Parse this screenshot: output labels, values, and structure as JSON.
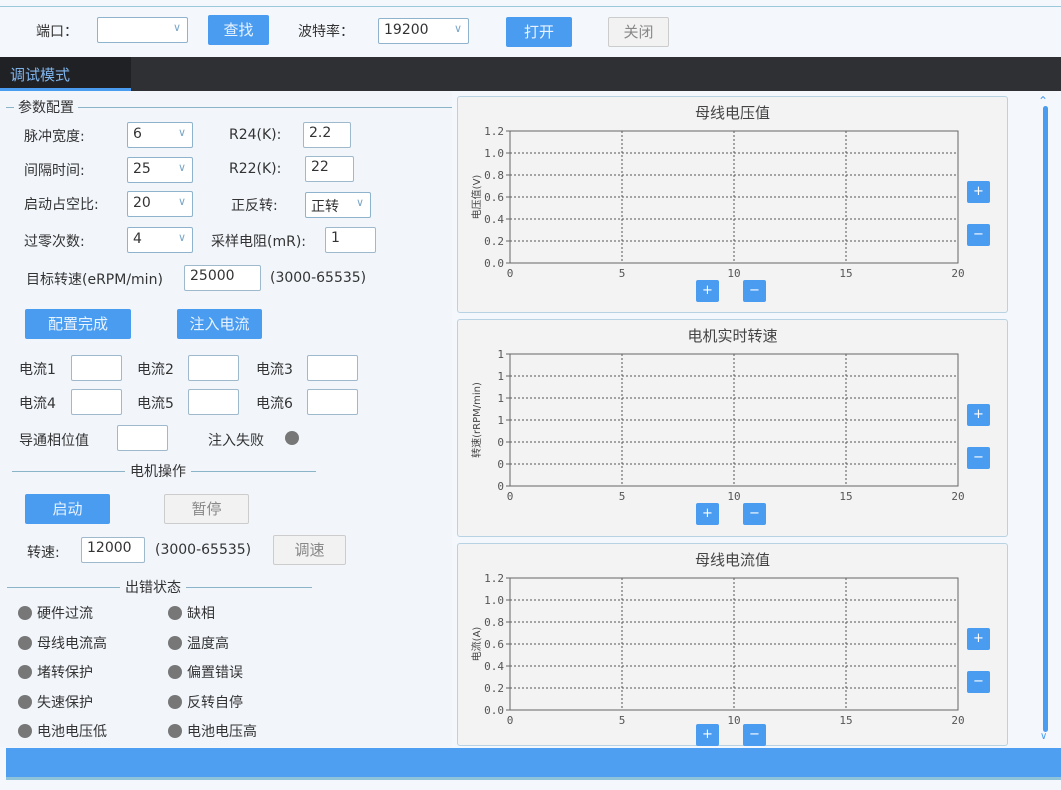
{
  "toolbar": {
    "port_label": "端口：",
    "port_value": "",
    "find_label": "查找",
    "baud_label": "波特率：",
    "baud_value": "19200",
    "open_label": "打开",
    "close_label": "关闭"
  },
  "tabs": [
    {
      "label": "调试模式",
      "active": true
    }
  ],
  "params": {
    "title": "参数配置",
    "pulse_width_label": "脉冲宽度:",
    "pulse_width": "6",
    "r24_label": "R24(K):",
    "r24": "2.2",
    "interval_label": "间隔时间:",
    "interval": "25",
    "r22_label": "R22(K):",
    "r22": "22",
    "duty_label": "启动占空比:",
    "duty": "20",
    "direction_label": "正反转:",
    "direction": "正转",
    "zero_cross_label": "过零次数:",
    "zero_cross": "4",
    "shunt_label": "采样电阻(mR):",
    "shunt": "1",
    "target_speed_label": "目标转速(eRPM/min)",
    "target_speed": "25000",
    "target_range": "(3000-65535)",
    "config_done": "配置完成",
    "inject_current": "注入电流",
    "currents": [
      {
        "label": "电流1",
        "value": ""
      },
      {
        "label": "电流2",
        "value": ""
      },
      {
        "label": "电流3",
        "value": ""
      },
      {
        "label": "电流4",
        "value": ""
      },
      {
        "label": "电流5",
        "value": ""
      },
      {
        "label": "电流6",
        "value": ""
      }
    ],
    "phase_label": "导通相位值",
    "phase_value": "",
    "inject_fail_label": "注入失败"
  },
  "motor": {
    "title": "电机操作",
    "start": "启动",
    "pause": "暂停",
    "speed_label": "转速:",
    "speed": "12000",
    "speed_range": "(3000-65535)",
    "adjust": "调速"
  },
  "errors": {
    "title": "出错状态",
    "items": [
      "硬件过流",
      "缺相",
      "母线电流高",
      "温度高",
      "堵转保护",
      "偏置错误",
      "失速保护",
      "反转自停",
      "电池电压低",
      "电池电压高"
    ]
  },
  "colors": {
    "accent": "#4a9cf0",
    "indicator_off": "#777777"
  },
  "chart_data": [
    {
      "type": "line",
      "title": "母线电压值",
      "ylabel": "电压值(V)",
      "xlim": [
        0,
        20
      ],
      "xticks": [
        "0",
        "5",
        "10",
        "15",
        "20"
      ],
      "yticks": [
        "0.0",
        "0.2",
        "0.4",
        "0.6",
        "0.8",
        "1.0",
        "1.2"
      ],
      "ylim": [
        0,
        1.2
      ],
      "series": [],
      "grid": true
    },
    {
      "type": "line",
      "title": "电机实时转速",
      "ylabel": "转速(rRPM/min)",
      "xlim": [
        0,
        20
      ],
      "xticks": [
        "0",
        "5",
        "10",
        "15",
        "20"
      ],
      "yticks": [
        "0",
        "0",
        "0",
        "1",
        "1",
        "1",
        "1"
      ],
      "series": [],
      "grid": true
    },
    {
      "type": "line",
      "title": "母线电流值",
      "ylabel": "电流(A)",
      "xlim": [
        0,
        20
      ],
      "xticks": [
        "0",
        "5",
        "10",
        "15",
        "20"
      ],
      "yticks": [
        "0.0",
        "0.2",
        "0.4",
        "0.6",
        "0.8",
        "1.0",
        "1.2"
      ],
      "ylim": [
        0,
        1.2
      ],
      "series": [],
      "grid": true
    }
  ],
  "zoom_buttons": {
    "plus": "+",
    "minus": "−"
  }
}
